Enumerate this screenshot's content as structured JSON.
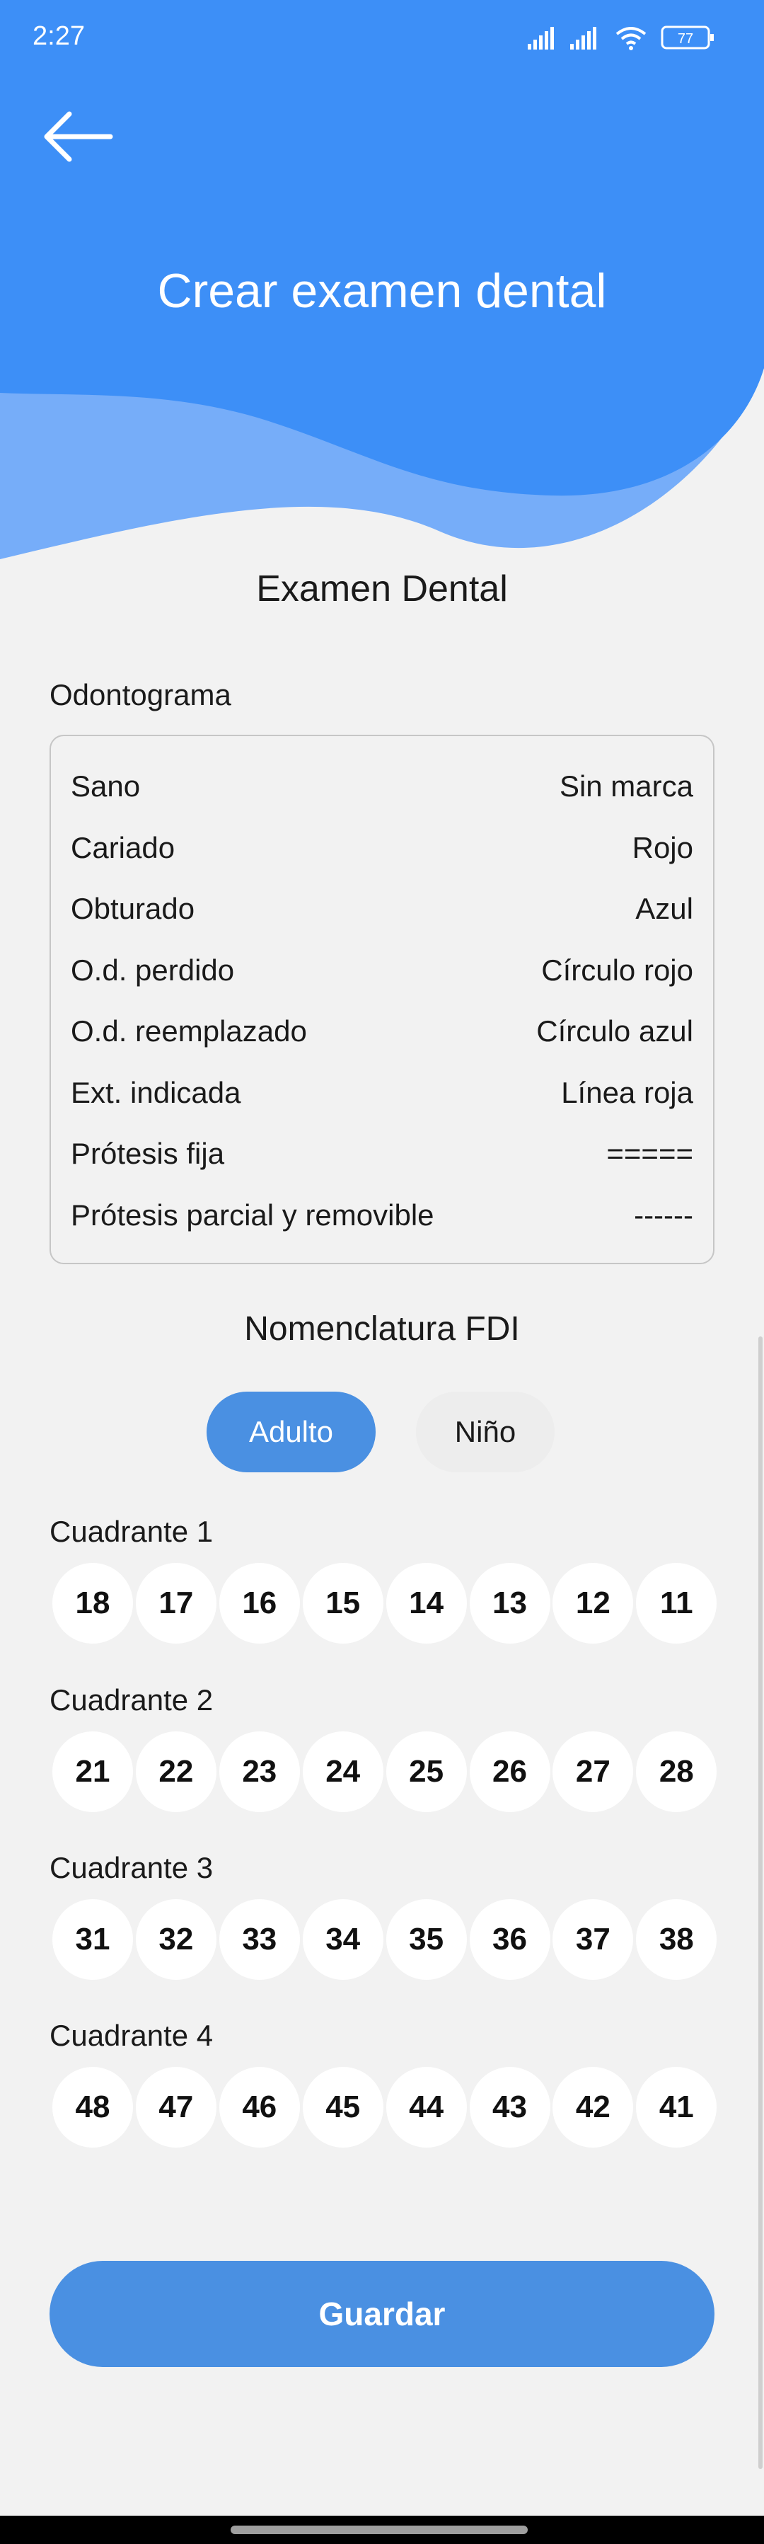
{
  "status_bar": {
    "time": "2:27",
    "battery": "77"
  },
  "header": {
    "back_icon": "arrow-left-icon",
    "title": "Crear examen dental",
    "color_primary": "#3d8ff7",
    "color_wave": "#76adf9"
  },
  "exam": {
    "section_title": "Examen Dental",
    "odontogram_label": "Odontograma",
    "legend": [
      {
        "name": "Sano",
        "mark": "Sin marca"
      },
      {
        "name": "Cariado",
        "mark": "Rojo"
      },
      {
        "name": "Obturado",
        "mark": "Azul"
      },
      {
        "name": "O.d. perdido",
        "mark": "Círculo rojo"
      },
      {
        "name": "O.d. reemplazado",
        "mark": "Círculo azul"
      },
      {
        "name": "Ext. indicada",
        "mark": "Línea roja"
      },
      {
        "name": "Prótesis fija",
        "mark": "====="
      },
      {
        "name": "Prótesis parcial y removible",
        "mark": "------"
      }
    ]
  },
  "fdi": {
    "title": "Nomenclatura FDI",
    "toggle": {
      "adult": "Adulto",
      "child": "Niño",
      "selected": "Adulto"
    },
    "quadrants": [
      {
        "label": "Cuadrante 1",
        "teeth": [
          "18",
          "17",
          "16",
          "15",
          "14",
          "13",
          "12",
          "11"
        ]
      },
      {
        "label": "Cuadrante 2",
        "teeth": [
          "21",
          "22",
          "23",
          "24",
          "25",
          "26",
          "27",
          "28"
        ]
      },
      {
        "label": "Cuadrante 3",
        "teeth": [
          "31",
          "32",
          "33",
          "34",
          "35",
          "36",
          "37",
          "38"
        ]
      },
      {
        "label": "Cuadrante 4",
        "teeth": [
          "48",
          "47",
          "46",
          "45",
          "44",
          "43",
          "42",
          "41"
        ]
      }
    ]
  },
  "actions": {
    "save": "Guardar",
    "accent": "#4a90e2"
  }
}
